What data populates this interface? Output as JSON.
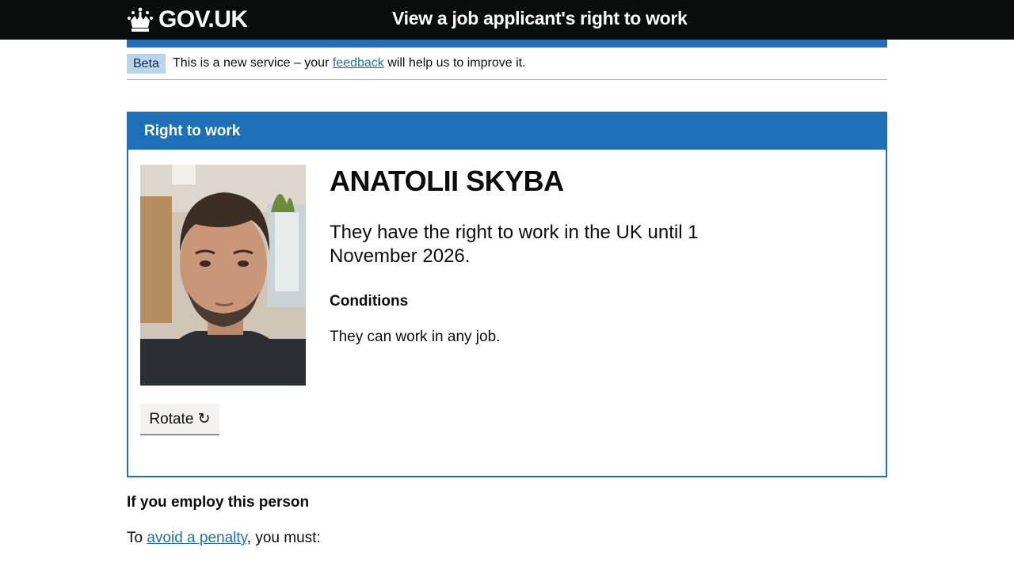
{
  "header": {
    "logo_text": "GOV.UK",
    "service_name": "View a job applicant's right to work"
  },
  "phase_banner": {
    "tag": "Beta",
    "text_before": "This is a new service – your",
    "link": "feedback",
    "text_after": "will help us to improve it."
  },
  "card": {
    "title": "Right to work",
    "name": "ANATOLII SKYBA",
    "rtw_statement": "They have the right to work in the UK until 1 November 2026.",
    "conditions_heading": "Conditions",
    "conditions_text": "They can work in any job.",
    "rotate_label": "Rotate ↻"
  },
  "employ": {
    "heading": "If you employ this person",
    "to": "To",
    "penalty_link": "avoid a penalty",
    "must": ", you must:"
  },
  "colors": {
    "header_bg": "#0b0c0c",
    "brand_blue": "#1d70b8",
    "beta_tag_bg": "#bbd4ea",
    "button_bg": "#f3f2f1"
  }
}
